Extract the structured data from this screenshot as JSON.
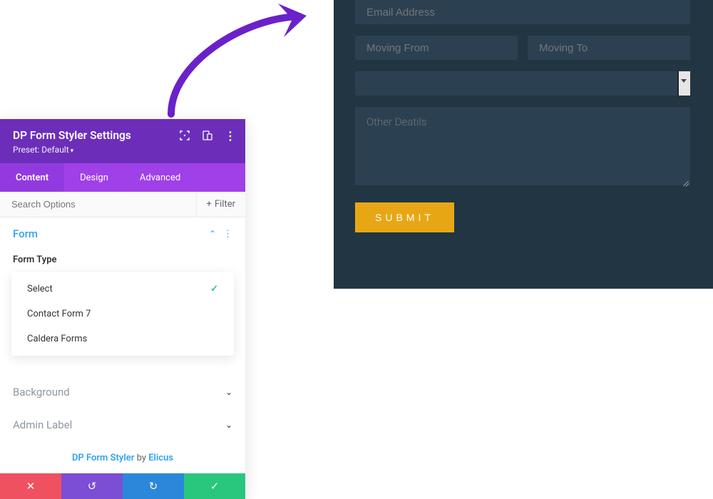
{
  "preview": {
    "email_placeholder": "Email Address",
    "from_placeholder": "Moving From",
    "to_placeholder": "Moving To",
    "details_placeholder": "Other Deatils",
    "submit_label": "SUBMIT"
  },
  "panel": {
    "title": "DP Form Styler Settings",
    "preset": "Preset: Default",
    "tabs": {
      "content": "Content",
      "design": "Design",
      "advanced": "Advanced"
    },
    "search_placeholder": "Search Options",
    "filter_label": "Filter",
    "sections": {
      "form": "Form",
      "background": "Background",
      "admin_label": "Admin Label"
    },
    "form_type_label": "Form Type",
    "dropdown": {
      "select": "Select",
      "cf7": "Contact Form 7",
      "caldera": "Caldera Forms"
    },
    "footer": {
      "product": "DP Form Styler",
      "by": " by ",
      "author": "Elicus"
    }
  }
}
